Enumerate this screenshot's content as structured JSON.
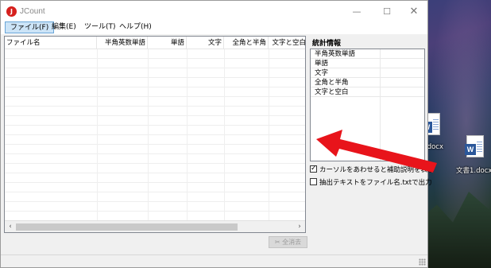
{
  "window": {
    "title": "JCount",
    "app_icon": "J",
    "controls": {
      "minimize": "—",
      "maximize": "☐",
      "close": "✕"
    }
  },
  "menu": [
    {
      "label": "ファイル(F)",
      "active": true
    },
    {
      "label": "編集(E)",
      "active": false
    },
    {
      "label": "ツール(T)",
      "active": false
    },
    {
      "label": "ヘルプ(H)",
      "active": false
    }
  ],
  "table": {
    "columns": [
      "ファイル名",
      "半角英数単語",
      "単語",
      "文字",
      "全角と半角",
      "文字と空白"
    ]
  },
  "stats": {
    "title": "統計情報",
    "rows": [
      "半角英数単語",
      "単語",
      "文字",
      "全角と半角",
      "文字と空白"
    ]
  },
  "options": {
    "tooltip": {
      "label": "カーソルをあわせると補助説明を表示",
      "checked": true
    },
    "export": {
      "label": "抽出テキストをファイル名.txtで出力",
      "checked": false
    }
  },
  "buttons": {
    "clear_all": "全消去"
  },
  "desktop": {
    "icons": [
      {
        "label": "文書.docx",
        "name": "word-document-icon"
      },
      {
        "label": "文書1.docx",
        "name": "word-document-icon"
      }
    ]
  },
  "colors": {
    "arrow": "#e8141b",
    "menu_active_bg": "#cce4f7",
    "word_blue": "#2b579a"
  }
}
